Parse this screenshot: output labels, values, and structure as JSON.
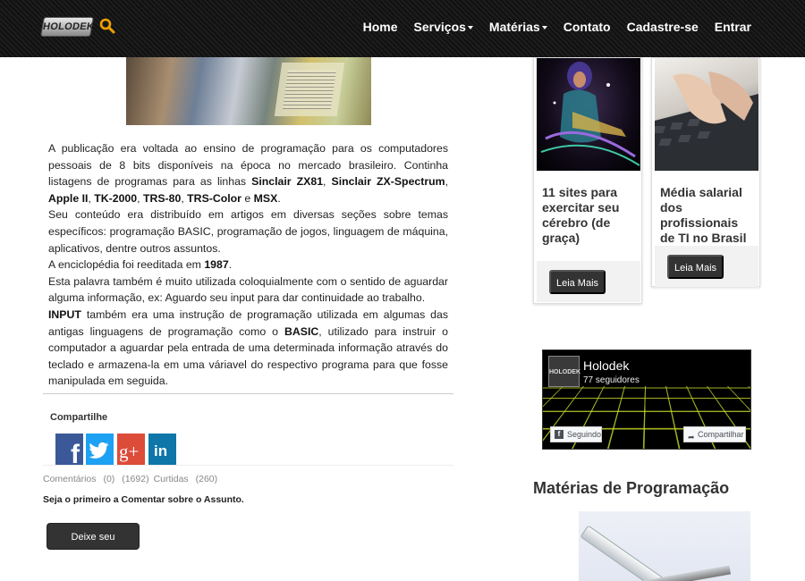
{
  "header": {
    "logo_text": "HOLODEK",
    "menu": [
      {
        "label": "Home",
        "dropdown": false
      },
      {
        "label": "Serviços",
        "dropdown": true
      },
      {
        "label": "Matérias",
        "dropdown": true
      },
      {
        "label": "Contato",
        "dropdown": false
      },
      {
        "label": "Cadastre-se",
        "dropdown": false
      },
      {
        "label": "Entrar",
        "dropdown": false
      }
    ],
    "colors": {
      "background": "#161616",
      "text": "#ffffff",
      "search_icon": "#f0a000"
    }
  },
  "article": {
    "p1": {
      "t1": "A publicação era voltada ao ensino de programação para os computadores pessoais de 8 bits disponíveis na época no mercado brasileiro. Continha listagens de programas para as linhas ",
      "b1": "Sinclair ZX81",
      "t2": ", ",
      "b2": "Sinclair ZX-Spectrum",
      "t3": ", ",
      "b3": "Apple II",
      "t4": ", ",
      "b4": "TK-2000",
      "t5": ", ",
      "b5": "TRS-80",
      "t6": ", ",
      "b6": "TRS-Color",
      "t7": " e ",
      "b7": "MSX",
      "t8": "."
    },
    "p2": "Seu conteúdo era distribuído em artigos em diversas seções sobre temas específicos: programação BASIC, programação de jogos, linguagem de máquina, aplicativos, dentre outros assuntos.",
    "p3": {
      "t1": "A enciclopédia foi reeditada em ",
      "b1": "1987",
      "t2": "."
    },
    "p4": "Esta palavra também é muito utilizada coloquialmente com o sentido de aguardar alguma informação, ex: Aguardo seu input para dar continuidade ao trabalho.",
    "p5": {
      "b1": "INPUT",
      "t1": " também era uma instrução de programação utilizada em algumas das antigas linguagens de programação como o ",
      "b2": "BASIC",
      "t2": ", utilizado para instruir o computador a aguardar pela entrada de uma determinada informação através do teclado e armazena-la em uma váriavel do respectivo programa para que fosse manipulada em seguida."
    }
  },
  "share": {
    "title": "Compartilhe",
    "buttons": [
      {
        "name": "facebook",
        "icon": "facebook-icon",
        "glyph": "f",
        "color": "#3b5998"
      },
      {
        "name": "twitter",
        "icon": "twitter-icon",
        "glyph": "",
        "color": "#1da1f2"
      },
      {
        "name": "google-plus",
        "icon": "google-plus-icon",
        "glyph": "g+",
        "color": "#dd4b39"
      },
      {
        "name": "linkedin",
        "icon": "linkedin-icon",
        "glyph": "in",
        "color": "#0e76a8"
      }
    ]
  },
  "stats": {
    "comments_label": "Comentários",
    "comments_count": "(0)",
    "views": "(1692)",
    "likes_label": "Curtidas",
    "likes_count": "(260)"
  },
  "comments": {
    "first_prompt": "Seja o primeiro a Comentar sobre o Assunto.",
    "button_label": "Deixe seu Comentário"
  },
  "sidebar": {
    "cards": [
      {
        "title": "11 sites para exercitar seu cérebro (de graça)",
        "button": "Leia Mais"
      },
      {
        "title": "Média salarial dos profissionais de TI no Brasil",
        "button": "Leia Mais"
      }
    ],
    "facebook": {
      "page_name": "Holodek",
      "followers": "77 seguidores",
      "avatar_text": "HOLODEK",
      "follow_label": "Seguindo",
      "share_label": "Compartilhar"
    },
    "section_title": "Matérias de Programação"
  }
}
